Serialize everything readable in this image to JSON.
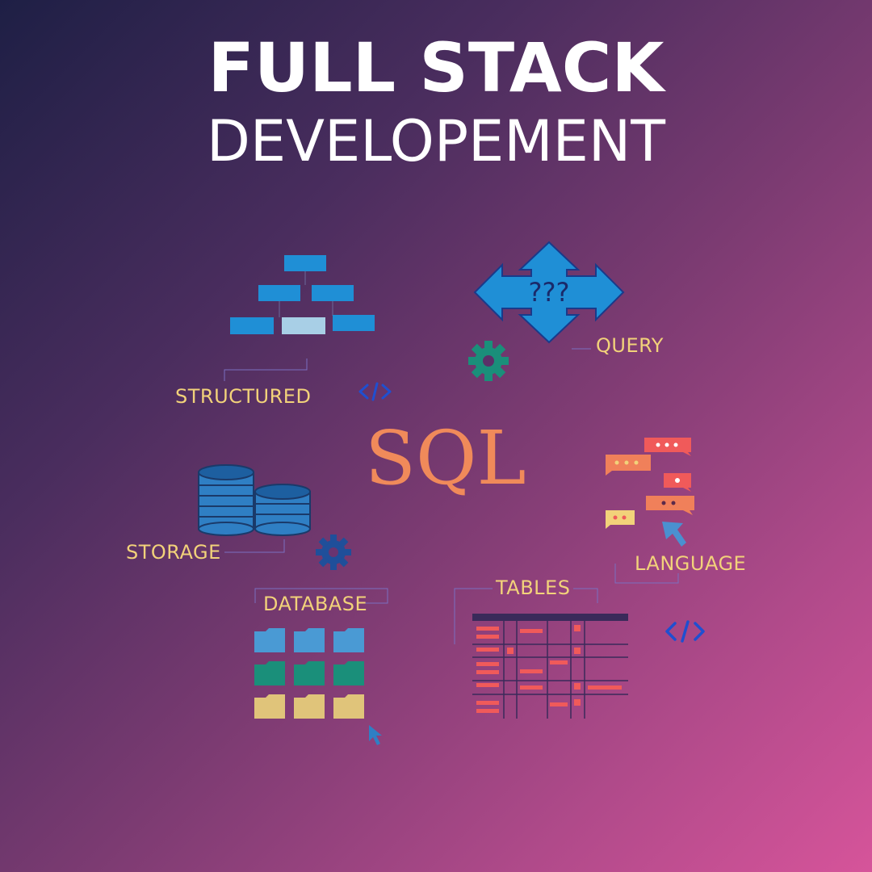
{
  "title": {
    "line1": "FULL STACK",
    "line2": "DEVELOPEMENT"
  },
  "center_text": "SQL",
  "labels": {
    "structured": "STRUCTURED",
    "query": "QUERY",
    "storage": "STORAGE",
    "database": "DATABASE",
    "tables": "TABLES",
    "language": "LANGUAGE"
  },
  "query_symbol": "???",
  "icons": [
    "org-chart-icon",
    "arrows-cross-icon",
    "gear-icon",
    "code-icon",
    "database-stack-icon",
    "folder-grid-icon",
    "chat-bubbles-icon",
    "cursor-icon",
    "table-icon"
  ],
  "colors": {
    "accent_yellow": "#f2d27a",
    "sql_orange": "#f08a5a",
    "blue": "#1f8fd6",
    "teal": "#1a8f7a",
    "code_blue": "#1f4fd0",
    "background_start": "#1e1f45",
    "background_end": "#d6549a"
  }
}
